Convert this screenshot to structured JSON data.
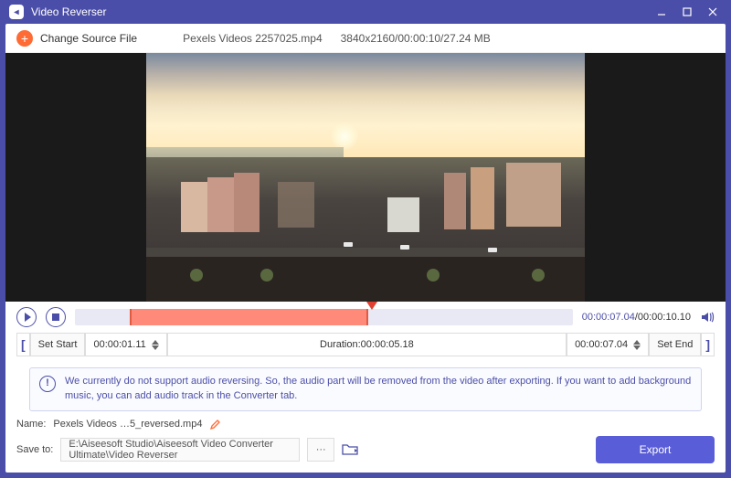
{
  "titlebar": {
    "title": "Video Reverser"
  },
  "header": {
    "change_label": "Change Source File",
    "filename": "Pexels Videos 2257025.mp4",
    "meta": "3840x2160/00:00:10/27.24 MB"
  },
  "playback": {
    "current_time": "00:00:07.04",
    "total_time": "/00:00:10.10"
  },
  "range": {
    "set_start_label": "Set Start",
    "start_time": "00:00:01.11",
    "duration_label": "Duration:",
    "duration_value": "00:00:05.18",
    "end_time": "00:00:07.04",
    "set_end_label": "Set End"
  },
  "notice": {
    "text": "We currently do not support audio reversing. So, the audio part will be removed from the video after exporting. If you want to add background music, you can add audio track in the Converter tab."
  },
  "output": {
    "name_label": "Name:",
    "name_value": "Pexels Videos …5_reversed.mp4",
    "save_label": "Save to:",
    "save_path": "E:\\Aiseesoft Studio\\Aiseesoft Video Converter Ultimate\\Video Reverser",
    "browse": "···",
    "export_label": "Export"
  }
}
